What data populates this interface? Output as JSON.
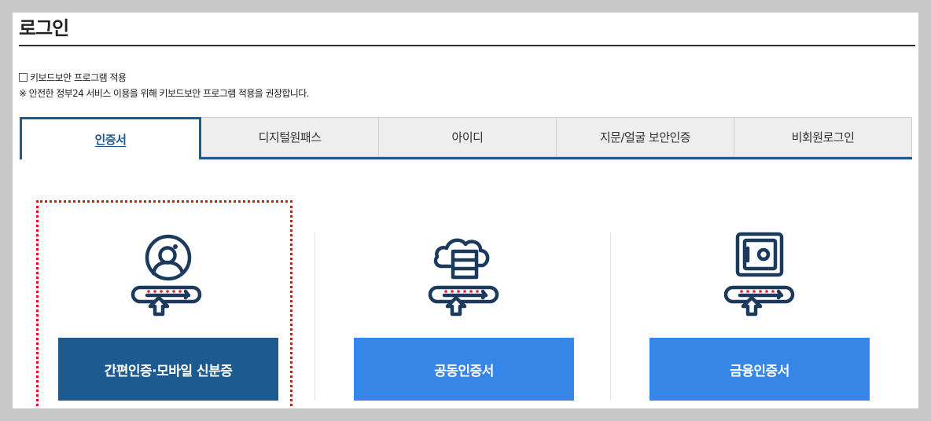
{
  "page": {
    "title": "로그인"
  },
  "keyboard_security": {
    "label": "키보드보안 프로그램 적용",
    "checked": false,
    "notice": "※ 안전한 정부24 서비스 이용을 위해 키보드보안 프로그램 적용을 권장합니다."
  },
  "tabs": [
    {
      "label": "인증서",
      "active": true
    },
    {
      "label": "디지털원패스",
      "active": false
    },
    {
      "label": "아이디",
      "active": false
    },
    {
      "label": "지문/얼굴 보안인증",
      "active": false
    },
    {
      "label": "비회원로그인",
      "active": false
    }
  ],
  "options": [
    {
      "label": "간편인증·모바일 신분증",
      "icon": "user-certificate-icon",
      "selected": true
    },
    {
      "label": "공동인증서",
      "icon": "cloud-server-certificate-icon",
      "selected": false
    },
    {
      "label": "금융인증서",
      "icon": "safe-certificate-icon",
      "selected": false
    }
  ],
  "colors": {
    "primary_dark": "#1d5a8f",
    "primary_light": "#3586e6",
    "icon_navy": "#1b3a5c",
    "password_dot_red": "#e01d2d",
    "focus_outline": "#e20f0f"
  }
}
